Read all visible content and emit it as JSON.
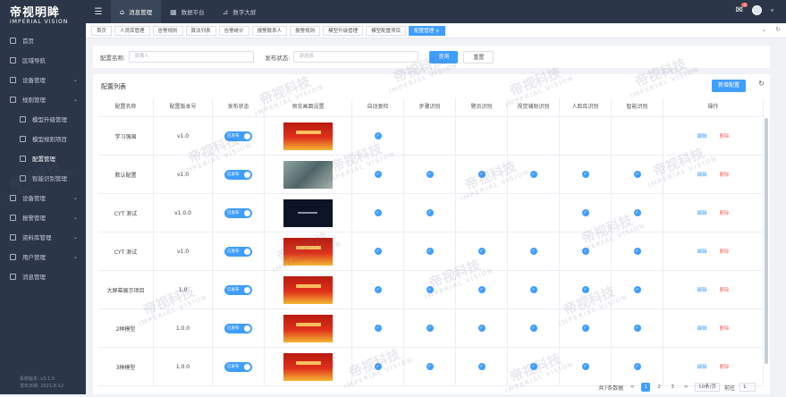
{
  "app": {
    "logo_title": "帝视明眸",
    "logo_subtitle": "IMPERIAL VISION"
  },
  "sidebar": {
    "items": [
      {
        "label": "首页",
        "icon": "home-icon"
      },
      {
        "label": "区域导航",
        "icon": "area-icon"
      },
      {
        "label": "设备管理",
        "icon": "device-icon"
      },
      {
        "label": "规则管理",
        "icon": "rule-icon"
      },
      {
        "label": "模型升级管理",
        "icon": "upgrade-icon"
      },
      {
        "label": "模型规则项目",
        "icon": "project-icon"
      },
      {
        "label": "配置管理",
        "icon": "config-icon"
      },
      {
        "label": "智能识别管理",
        "icon": "recognition-icon"
      },
      {
        "label": "设备管理",
        "icon": "equipment-icon"
      },
      {
        "label": "报警管理",
        "icon": "alarm-icon"
      },
      {
        "label": "资料库管理",
        "icon": "library-icon"
      },
      {
        "label": "用户管理",
        "icon": "user-icon"
      },
      {
        "label": "消息管理",
        "icon": "message-icon"
      }
    ],
    "version_line1": "系统版本: v3.1.0",
    "version_line2": "发布日期: 2021-8-12"
  },
  "topbar": {
    "nav": [
      {
        "label": "消息管理"
      },
      {
        "label": "数据平台"
      },
      {
        "label": "数字大屏"
      }
    ],
    "notification_count": "3",
    "user_caret": "v"
  },
  "tabs": [
    "首页",
    "人员库管理",
    "告警规则",
    "算法列表",
    "告警统计",
    "报警联系人",
    "报警规则",
    "模型升级管理",
    "模型配置项目",
    "配置管理"
  ],
  "search": {
    "name_label": "配置名称:",
    "name_placeholder": "请输入",
    "status_label": "发布状态:",
    "status_placeholder": "请选择",
    "query_button": "查询",
    "reset_button": "重置"
  },
  "list": {
    "title": "配置列表",
    "add_button": "新增配置",
    "columns": [
      "配置名称",
      "配置版本号",
      "发布状态",
      "预览画面设置",
      "自动复检",
      "步骤识别",
      "警员识别",
      "视觉辅助识别",
      "人脸库识别",
      "智能识别",
      "操作"
    ],
    "edit_label": "编辑",
    "delete_label": "删除",
    "rows": [
      {
        "name": "学习强国",
        "version": "v1.0",
        "status": "已发布",
        "thumb": "red",
        "checks": [
          1,
          0,
          0,
          0,
          0,
          0
        ]
      },
      {
        "name": "默认配置",
        "version": "v1.0",
        "status": "已发布",
        "thumb": "photo",
        "checks": [
          1,
          1,
          1,
          1,
          1,
          1
        ]
      },
      {
        "name": "CYT 测试",
        "version": "v1.0.0",
        "status": "已发布",
        "thumb": "dark",
        "checks": [
          1,
          1,
          0,
          0,
          1,
          1
        ]
      },
      {
        "name": "CYT 测试",
        "version": "v1.0",
        "status": "已发布",
        "thumb": "red",
        "checks": [
          1,
          1,
          1,
          1,
          1,
          1
        ]
      },
      {
        "name": "大屏幕展示项目",
        "version": "1.0",
        "status": "已发布",
        "thumb": "red",
        "checks": [
          1,
          1,
          1,
          1,
          1,
          1
        ]
      },
      {
        "name": "2种模型",
        "version": "1.0.0",
        "status": "已发布",
        "thumb": "red",
        "checks": [
          1,
          1,
          1,
          1,
          1,
          1
        ]
      },
      {
        "name": "3种模型",
        "version": "1.0.0",
        "status": "已发布",
        "thumb": "red",
        "checks": [
          1,
          1,
          1,
          1,
          1,
          1
        ]
      }
    ]
  },
  "pagination": {
    "total": "共7条数据",
    "pages": [
      "1",
      "2",
      "3"
    ],
    "prev": "<",
    "next": ">",
    "page_size": "10条/页",
    "goto_label": "前往",
    "goto_value": "1"
  },
  "watermark": {
    "text": "帝视科技",
    "sub": "IMPERIAL VISION"
  },
  "colors": {
    "primary": "#409eff",
    "danger": "#f56c6c",
    "sidebar": "#2b3648"
  }
}
